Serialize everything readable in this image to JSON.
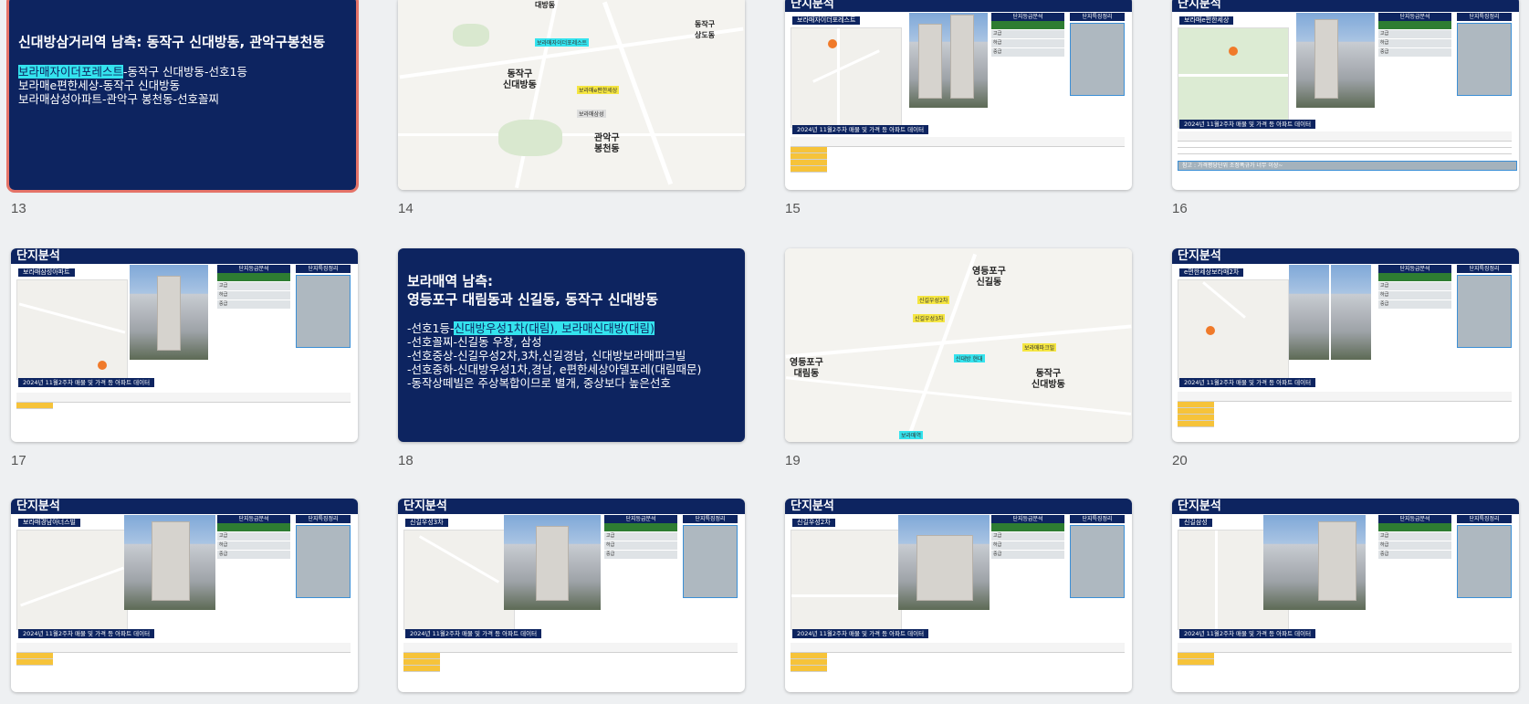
{
  "slides": [
    {
      "num": "13",
      "type": "title",
      "title": "신대방삼거리역 남측: 동작구 신대방동, 관악구봉천동",
      "lines": [
        {
          "hl": "보라매자이더포레스트",
          "rest": "-동작구 신대방동-선호1등"
        },
        {
          "hl": "",
          "rest": "보라매e편한세상-동작구 신대방동"
        },
        {
          "hl": "",
          "rest": "보라매삼성아파트-관악구 봉천동-선호꼴찌"
        }
      ]
    },
    {
      "num": "14",
      "type": "map",
      "labels": [
        "동작구\n신대방동",
        "관악구\n봉천동",
        "동작구\n상도동",
        "대방동"
      ],
      "cyan": [
        "보라매자이더포레스트"
      ],
      "yellow": [
        "보라매e편한세상",
        "보라매삼성"
      ]
    },
    {
      "num": "15",
      "type": "analysis",
      "header": "단지분석",
      "name": "보라매자이더포레스트",
      "grade_title": "단지등급분석",
      "feature_title": "단지특징정리",
      "grades": [
        "상급",
        "고급",
        "하급",
        "중급"
      ],
      "data_title": "2024년 11월2주차 매물 및 가격 등 아파트 데이터"
    },
    {
      "num": "16",
      "type": "analysis",
      "header": "단지분석",
      "name": "보라매e편한세상",
      "grade_title": "단지등급분석",
      "feature_title": "단지특징정리",
      "grades": [
        "상급",
        "고급",
        "하급",
        "중급"
      ],
      "data_title": "2024년 11월2주차 매물 및 가격 등 아파트 데이터",
      "note": "참고 : 가격평당단위 조정폭규가 너무 이상~"
    },
    {
      "num": "17",
      "type": "analysis",
      "header": "단지분석",
      "name": "보라매삼성아파트",
      "grade_title": "단지등급분석",
      "feature_title": "단지특징정리",
      "grades": [
        "상급",
        "고급",
        "하급",
        "중급"
      ],
      "data_title": "2024년 11월2주차 매물 및 가격 등 아파트 데이터"
    },
    {
      "num": "18",
      "type": "title",
      "title": "보라매역 남측:\n영등포구 대림동과 신길동, 동작구 신대방동",
      "lines": [
        {
          "pre": "-선호1등-",
          "hl": "신대방우성1차(대림), 보라매신대방(대림)",
          "rest": ""
        },
        {
          "pre": "",
          "hl": "",
          "rest": "-선호꼴찌-신길동 우창, 삼성"
        },
        {
          "pre": "",
          "hl": "",
          "rest": "-선호중상-신길우성2차,3차,신길경남, 신대방보라매파크빌"
        },
        {
          "pre": "",
          "hl": "",
          "rest": "-선호중하-신대방우성1차,경남, e편한세상아델포레(대림때문)"
        },
        {
          "pre": "",
          "hl": "",
          "rest": "-동작상떼빌은 주상복합이므로 별개, 중상보다 높은선호"
        }
      ]
    },
    {
      "num": "19",
      "type": "map",
      "labels": [
        "영등포구\n신길동",
        "영등포구\n대림동",
        "동작구\n신대방동"
      ],
      "cyan": [
        "신대방 현대",
        "보라매역"
      ],
      "yellow": [
        "신길우성2차",
        "신길우성3차",
        "보라매파크빌"
      ]
    },
    {
      "num": "20",
      "type": "analysis",
      "header": "단지분석",
      "name": "e편한세상보라매2차",
      "grade_title": "단지등급분석",
      "feature_title": "단지특징정리",
      "grades": [
        "상급",
        "고급",
        "하급",
        "중급"
      ],
      "data_title": "2024년 11월2주차 매물 및 가격 등 아파트 데이터"
    },
    {
      "num": "21",
      "type": "analysis",
      "header": "단지분석",
      "name": "보라매경남아너스빌",
      "grade_title": "단지등급분석",
      "feature_title": "단지특징정리",
      "grades": [
        "상급",
        "고급",
        "하급",
        "중급"
      ],
      "data_title": "2024년 11월2주차 매물 및 가격 등 아파트 데이터"
    },
    {
      "num": "22",
      "type": "analysis",
      "header": "단지분석",
      "name": "신길우성3차",
      "grade_title": "단지등급분석",
      "feature_title": "단지특징정리",
      "grades": [
        "상급",
        "고급",
        "하급",
        "중급"
      ],
      "data_title": "2024년 11월2주차 매물 및 가격 등 아파트 데이터"
    },
    {
      "num": "23",
      "type": "analysis",
      "header": "단지분석",
      "name": "신길우성2차",
      "grade_title": "단지등급분석",
      "feature_title": "단지특징정리",
      "grades": [
        "상급",
        "고급",
        "하급",
        "중급"
      ],
      "data_title": "2024년 11월2주차 매물 및 가격 등 아파트 데이터"
    },
    {
      "num": "24",
      "type": "analysis",
      "header": "단지분석",
      "name": "신길삼성",
      "grade_title": "단지등급분석",
      "feature_title": "단지특징정리",
      "grades": [
        "상급",
        "고급",
        "하급",
        "중급"
      ],
      "data_title": "2024년 11월2주차 매물 및 가격 등 아파트 데이터"
    }
  ],
  "colors": {
    "navy": "#0d2460",
    "highlight": "#34e3ee",
    "selection": "#e57368",
    "grade_green": "#2e7d32",
    "data_yellow": "#f6c33a"
  }
}
